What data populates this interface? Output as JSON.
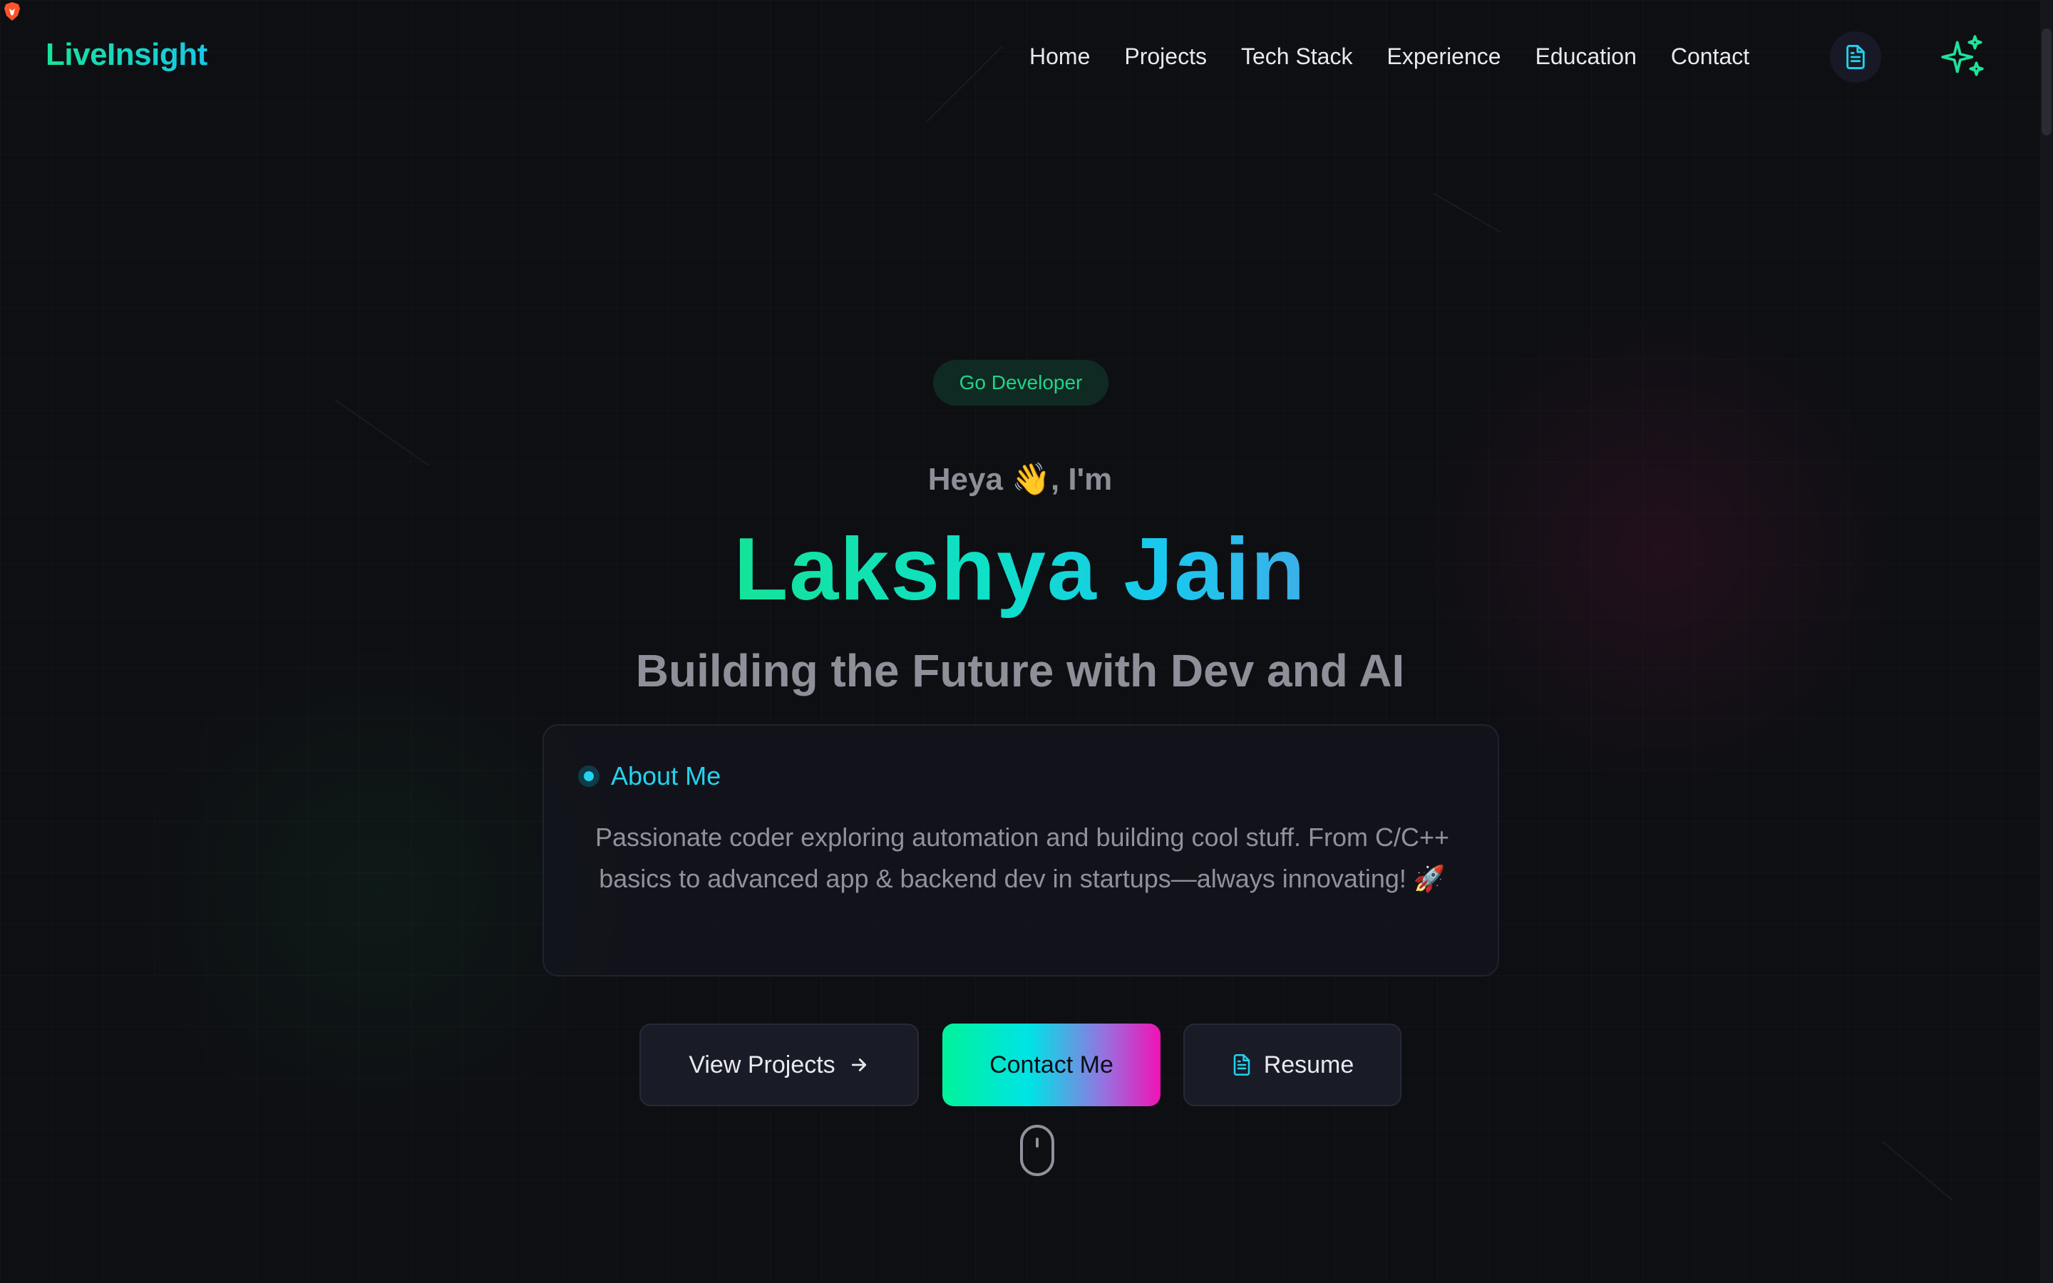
{
  "header": {
    "logo": "LiveInsight",
    "nav": [
      "Home",
      "Projects",
      "Tech Stack",
      "Experience",
      "Education",
      "Contact"
    ],
    "resume_icon": "file-text-icon",
    "theme_icon": "sparkles-icon"
  },
  "hero": {
    "badge": "Go Developer",
    "greeting": "Heya 👋, I'm",
    "name": "Lakshya Jain",
    "tagline": "Building the Future with Dev and AI"
  },
  "about": {
    "title": "About Me",
    "text": "Passionate coder exploring automation and building cool stuff. From C/C++ basics to advanced app & backend dev in startups—always innovating! 🚀"
  },
  "buttons": {
    "projects": "View Projects",
    "contact": "Contact Me",
    "resume": "Resume"
  },
  "colors": {
    "accent_green": "#14e39a",
    "accent_cyan": "#22d3ee",
    "accent_pink": "#f012b4",
    "background": "#0e0f13"
  }
}
